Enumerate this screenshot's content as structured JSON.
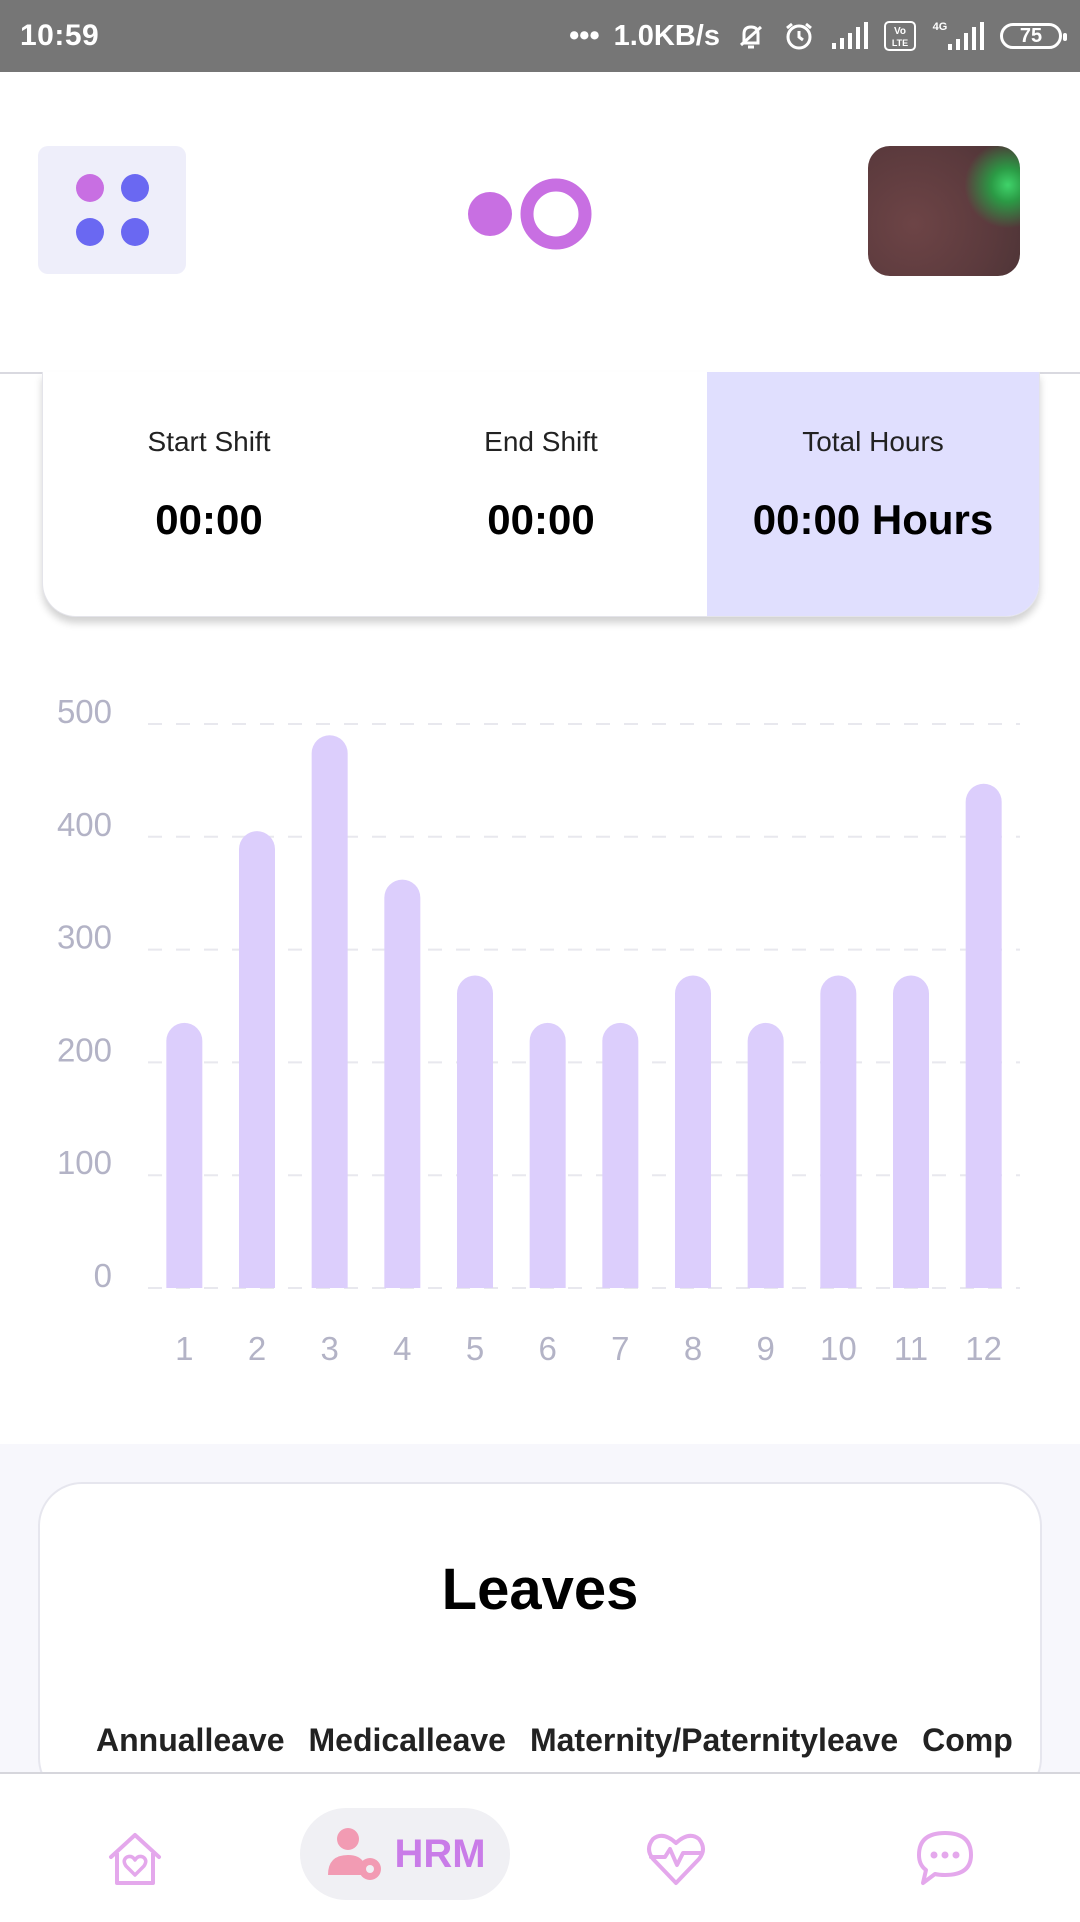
{
  "status_bar": {
    "time": "10:59",
    "speed": "1.0KB/s",
    "network_label": "4G",
    "volte_label": "Vo LTE",
    "battery": "75"
  },
  "header": {
    "menu_icon": "grid-dots-icon",
    "logo_icon": "app-logo",
    "avatar": "profile-picture"
  },
  "shift": {
    "start_label": "Start Shift",
    "start_value": "00:00",
    "end_label": "End Shift",
    "end_value": "00:00",
    "total_label": "Total Hours",
    "total_value": "00:00 Hours"
  },
  "chart_data": {
    "type": "bar",
    "categories": [
      "1",
      "2",
      "3",
      "4",
      "5",
      "6",
      "7",
      "8",
      "9",
      "10",
      "11",
      "12"
    ],
    "values": [
      235,
      405,
      490,
      362,
      277,
      235,
      235,
      277,
      235,
      277,
      277,
      447
    ],
    "yticks": [
      "0",
      "100",
      "200",
      "300",
      "400",
      "500"
    ],
    "ylim": [
      0,
      500
    ],
    "grid": true,
    "bar_color": "#dccefc",
    "label_color": "#b3b3c6",
    "grid_color": "#e8e8ee"
  },
  "leaves": {
    "title": "Leaves",
    "items": [
      "Annualleave",
      "Medicalleave",
      "Maternity/Paternityleave",
      "Comp"
    ]
  },
  "nav": {
    "home_icon": "home-heart-icon",
    "hrm_label": "HRM",
    "hrm_icon": "user-gear-icon",
    "health_icon": "heartbeat-icon",
    "chat_icon": "chat-bubble-icon",
    "accent": "#c97ce8"
  }
}
